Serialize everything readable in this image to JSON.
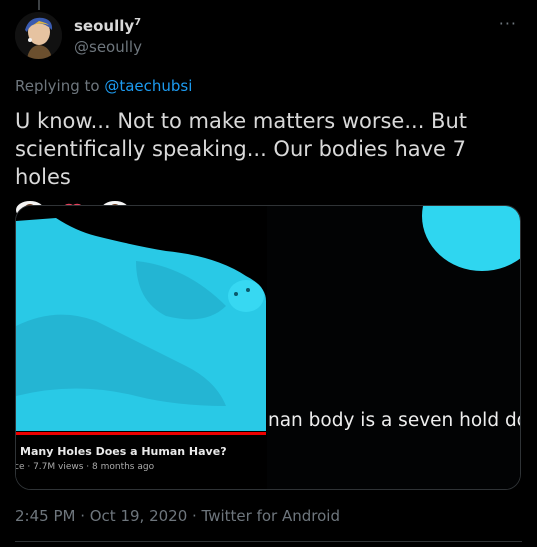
{
  "tweet": {
    "display_name": "seoully",
    "name_badge": "7",
    "handle": "@seoully",
    "more_label": "···",
    "replying_to_prefix": "Replying to ",
    "replying_to_handle": "@taechubsi",
    "text": "U know... Not to make matters worse... But scientifically speaking... Our bodies have 7 holes",
    "emojis": [
      "eye-emoji",
      "lips-emoji",
      "eye-emoji"
    ],
    "timestamp": "2:45 PM · Oct 19, 2020 · Twitter for Android"
  },
  "media": {
    "left_caption_title": "Many Holes Does a Human Have?",
    "left_caption_meta": "ce · 7.7M views · 8 months ago",
    "right_subtitle": "nan body is a seven hold do"
  },
  "colors": {
    "background": "#000000",
    "text": "#d9d9d9",
    "secondary": "#6e767d",
    "link": "#1d9bf0",
    "figure": "#2fd6f0"
  }
}
